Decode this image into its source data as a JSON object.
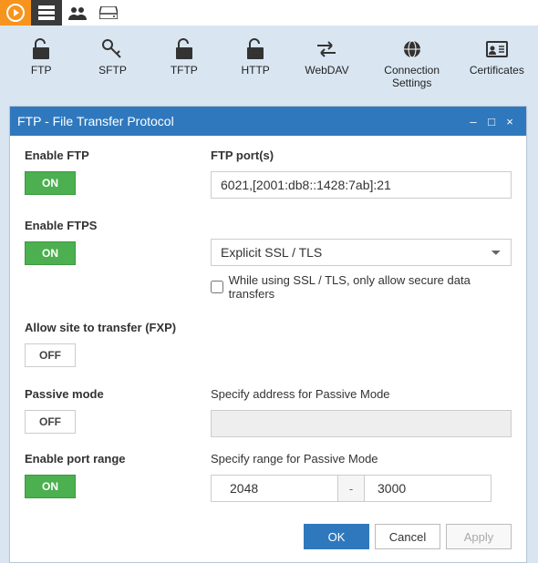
{
  "toolbar": {
    "items": [
      {
        "label": "FTP"
      },
      {
        "label": "SFTP"
      },
      {
        "label": "TFTP"
      },
      {
        "label": "HTTP"
      },
      {
        "label": "WebDAV"
      },
      {
        "label": "Connection Settings"
      },
      {
        "label": "Certificates"
      }
    ]
  },
  "panel": {
    "title": "FTP - File Transfer Protocol"
  },
  "form": {
    "enable_ftp_label": "Enable FTP",
    "enable_ftp_toggle": "ON",
    "ftp_ports_label": "FTP port(s)",
    "ftp_ports_value": "6021,[2001:db8::1428:7ab]:21",
    "enable_ftps_label": "Enable FTPS",
    "enable_ftps_toggle": "ON",
    "ftps_mode_selected": "Explicit SSL / TLS",
    "ftps_secure_only_label": "While using SSL / TLS, only allow secure data transfers",
    "fxp_label": "Allow site to transfer (FXP)",
    "fxp_toggle": "OFF",
    "passive_label": "Passive mode",
    "passive_toggle": "OFF",
    "passive_addr_label": "Specify address for Passive Mode",
    "passive_addr_value": "",
    "port_range_enable_label": "Enable port range",
    "port_range_toggle": "ON",
    "port_range_label": "Specify range for Passive Mode",
    "port_range_from": "2048",
    "port_range_sep": "-",
    "port_range_to": "3000"
  },
  "footer": {
    "ok": "OK",
    "cancel": "Cancel",
    "apply": "Apply"
  }
}
